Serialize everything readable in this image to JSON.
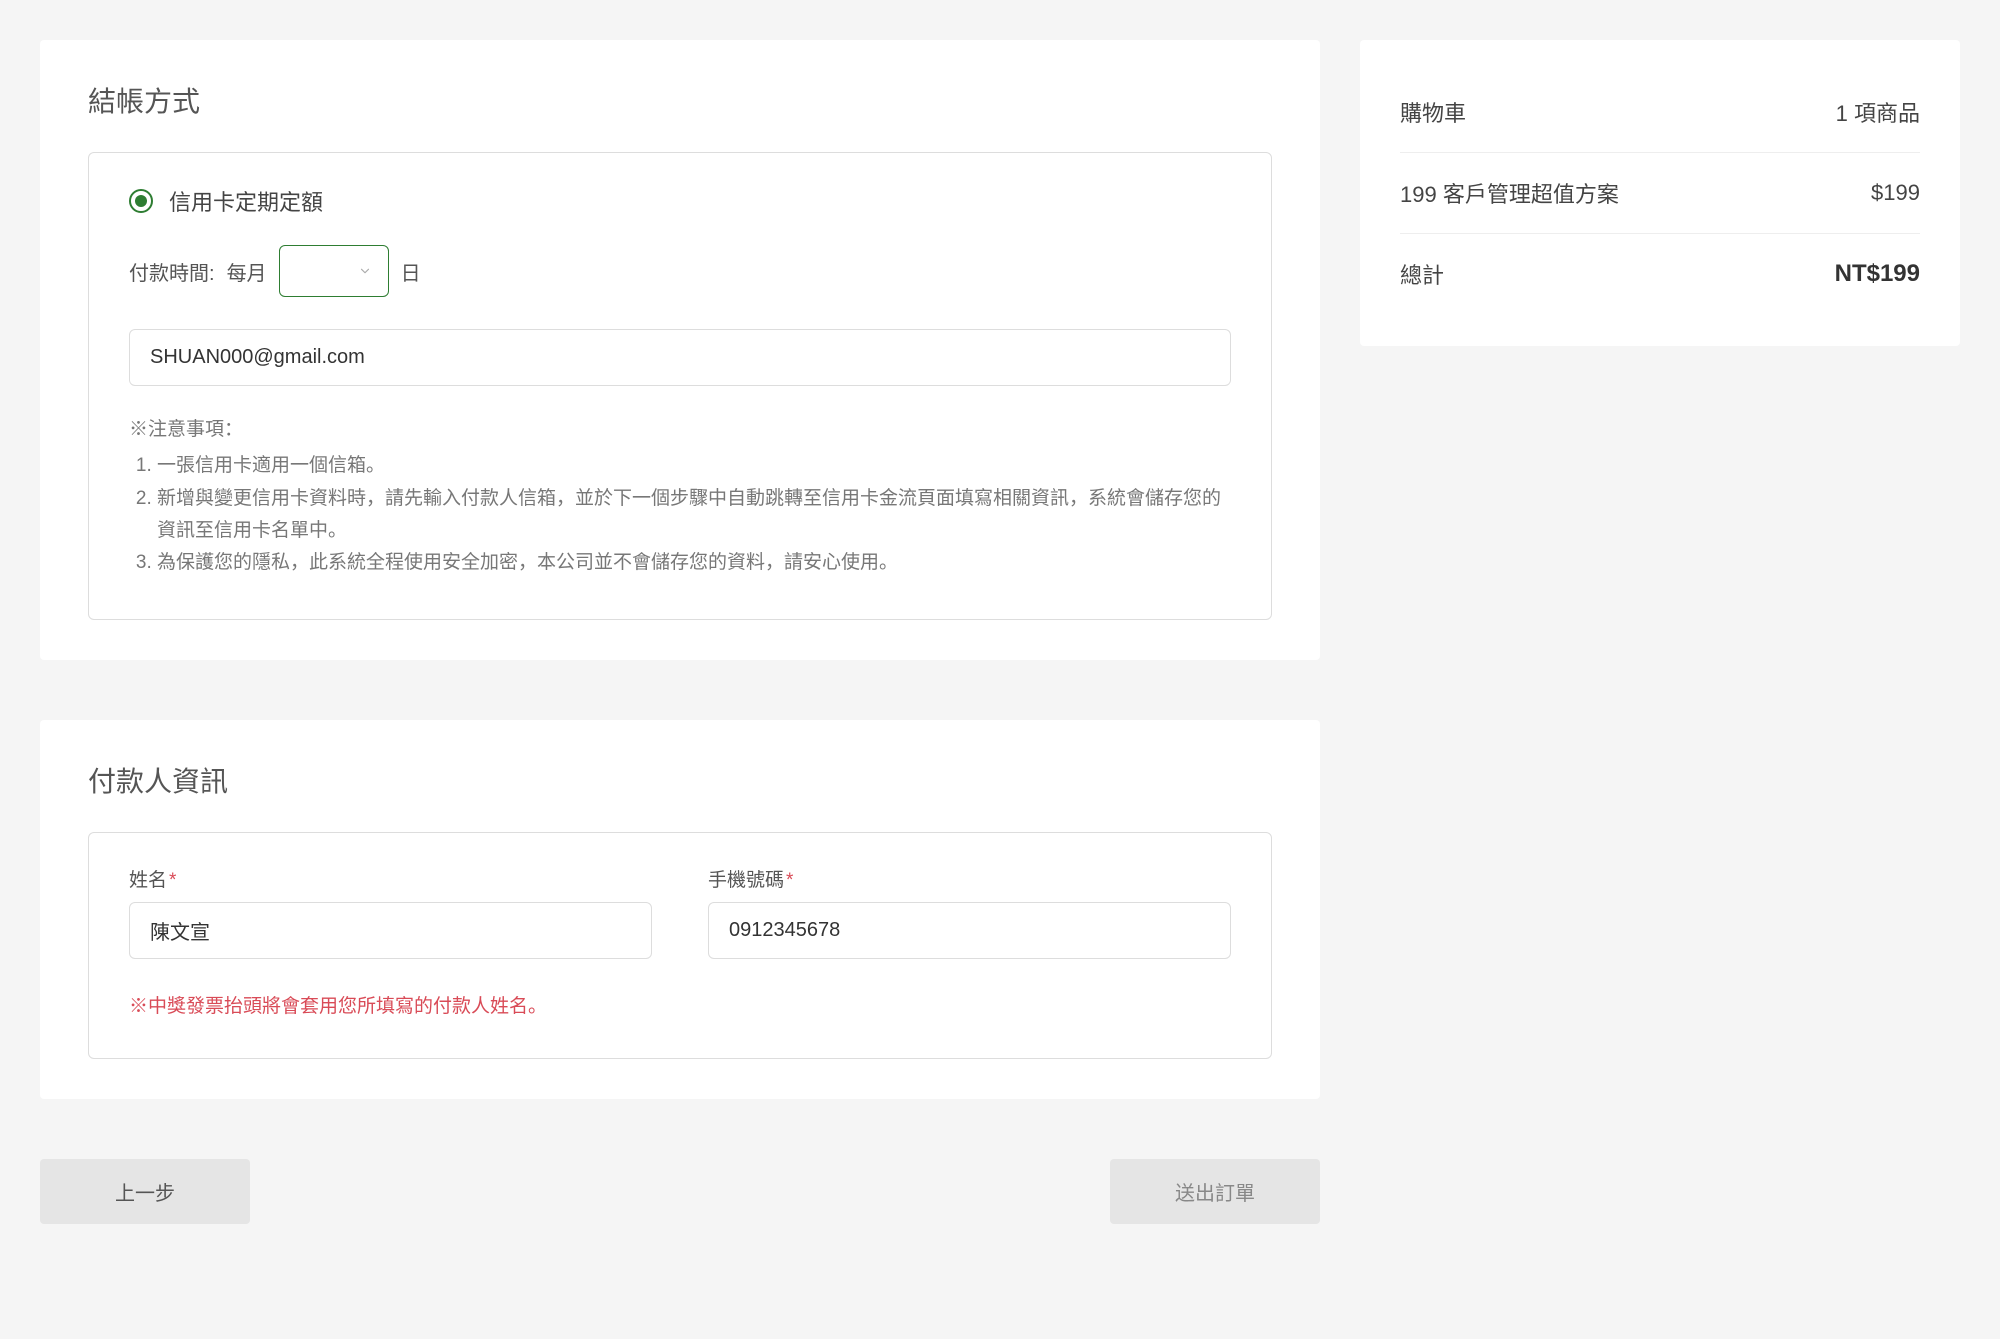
{
  "checkout": {
    "title": "結帳方式",
    "option_label": "信用卡定期定額",
    "payment_time_label": "付款時間:",
    "payment_time_prefix": "每月",
    "payment_time_suffix": "日",
    "email_value": "SHUAN000@gmail.com",
    "notes_header": "※注意事項：",
    "notes": [
      "一張信用卡適用一個信箱。",
      "新增與變更信用卡資料時，請先輸入付款人信箱，並於下一個步驟中自動跳轉至信用卡金流頁面填寫相關資訊，系統會儲存您的資訊至信用卡名單中。",
      "為保護您的隱私，此系統全程使用安全加密，本公司並不會儲存您的資料，請安心使用。"
    ]
  },
  "payer": {
    "title": "付款人資訊",
    "name_label": "姓名",
    "name_value": "陳文宣",
    "phone_label": "手機號碼",
    "phone_value": "0912345678",
    "warning": "※中獎發票抬頭將會套用您所填寫的付款人姓名。"
  },
  "buttons": {
    "back": "上一步",
    "submit": "送出訂單"
  },
  "cart": {
    "title": "購物車",
    "item_count": "1 項商品",
    "line_item_name": "199 客戶管理超值方案",
    "line_item_price": "$199",
    "total_label": "總計",
    "total_value": "NT$199"
  }
}
